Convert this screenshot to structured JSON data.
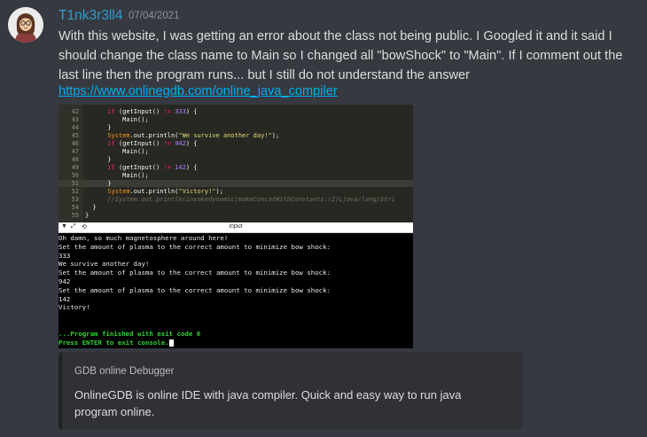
{
  "message": {
    "username": "T1nk3r3ll4",
    "timestamp": "07/04/2021",
    "text": "With this website, I was getting an error about the class not being public. I Googled it and it said I should change the class name to Main so I changed all \"bowShock\" to \"Main\". If I comment out the last line then the program runs... but I still do not understand the answer",
    "link": "https://www.onlinegdb.com/online_java_compiler"
  },
  "avatar": {
    "icon": "avatar-woman-glasses-icon",
    "bg": "#f2f2f2"
  },
  "screenshot": {
    "code": [
      {
        "ln": "42",
        "tokens": [
          [
            "      ",
            ""
          ],
          [
            "if",
            "kw"
          ],
          [
            " (getInput() ",
            ""
          ],
          [
            "!=",
            "kw"
          ],
          [
            " ",
            ""
          ],
          [
            "333",
            "num"
          ],
          [
            ") {",
            ""
          ]
        ]
      },
      {
        "ln": "43",
        "tokens": [
          [
            "          Main();",
            ""
          ]
        ]
      },
      {
        "ln": "44",
        "tokens": [
          [
            "      }",
            ""
          ]
        ]
      },
      {
        "ln": "45",
        "tokens": [
          [
            "      ",
            ""
          ],
          [
            "System",
            "sys"
          ],
          [
            ".out.println(",
            ""
          ],
          [
            "\"We survive another day!\"",
            "str"
          ],
          [
            ");",
            ""
          ]
        ]
      },
      {
        "ln": "46",
        "tokens": [
          [
            "      ",
            ""
          ],
          [
            "if",
            "kw"
          ],
          [
            " (getInput() ",
            ""
          ],
          [
            "!=",
            "kw"
          ],
          [
            " ",
            ""
          ],
          [
            "942",
            "num"
          ],
          [
            ") {",
            ""
          ]
        ]
      },
      {
        "ln": "47",
        "tokens": [
          [
            "          Main();",
            ""
          ]
        ]
      },
      {
        "ln": "48",
        "tokens": [
          [
            "      }",
            ""
          ]
        ]
      },
      {
        "ln": "49",
        "tokens": [
          [
            "      ",
            ""
          ],
          [
            "if",
            "kw"
          ],
          [
            " (getInput() ",
            ""
          ],
          [
            "!=",
            "kw"
          ],
          [
            " ",
            ""
          ],
          [
            "142",
            "num"
          ],
          [
            ") {",
            ""
          ]
        ]
      },
      {
        "ln": "50",
        "tokens": [
          [
            "          Main();",
            ""
          ]
        ]
      },
      {
        "ln": "51",
        "tokens": [
          [
            "      }",
            ""
          ]
        ],
        "highlight": true
      },
      {
        "ln": "52",
        "tokens": [
          [
            "      ",
            ""
          ],
          [
            "System",
            "sys"
          ],
          [
            ".out.println(",
            ""
          ],
          [
            "\"Victory!\"",
            "str"
          ],
          [
            ");",
            ""
          ]
        ]
      },
      {
        "ln": "53",
        "tokens": [
          [
            "      ",
            ""
          ],
          [
            "//System.out.println(invokedynamic(makeConcatWithConstants:(I)Ljava/lang/Stri",
            "cmt"
          ]
        ]
      },
      {
        "ln": "54",
        "tokens": [
          [
            "  }",
            ""
          ]
        ]
      },
      {
        "ln": "55",
        "tokens": [
          [
            "}",
            ""
          ]
        ]
      }
    ],
    "panel_title": "input",
    "console": [
      {
        "text": "Oh damn, so much magnetosphere around here!",
        "cls": ""
      },
      {
        "text": "Set the amount of plasma to the correct amount to minimize bow shock:",
        "cls": ""
      },
      {
        "text": "333",
        "cls": ""
      },
      {
        "text": "We survive another day!",
        "cls": ""
      },
      {
        "text": "Set the amount of plasma to the correct amount to minimize bow shock:",
        "cls": ""
      },
      {
        "text": "942",
        "cls": ""
      },
      {
        "text": "Set the amount of plasma to the correct amount to minimize bow shock:",
        "cls": ""
      },
      {
        "text": "142",
        "cls": ""
      },
      {
        "text": "Victory!",
        "cls": ""
      },
      {
        "text": "",
        "cls": ""
      },
      {
        "text": "",
        "cls": ""
      },
      {
        "text": "...Program finished with exit code 0",
        "cls": "green"
      },
      {
        "text": "Press ENTER to exit console.",
        "cls": "green",
        "cursor": true
      }
    ]
  },
  "embed": {
    "provider": "GDB online Debugger",
    "description": "OnlineGDB is online IDE with java compiler. Quick and easy way to run java program online."
  }
}
